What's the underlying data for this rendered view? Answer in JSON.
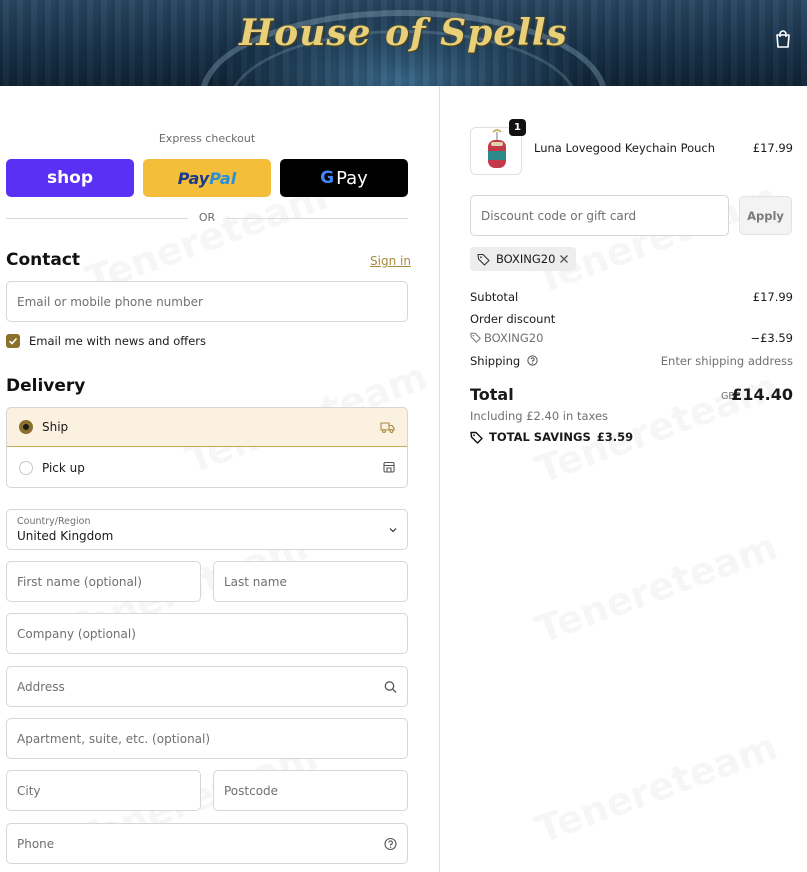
{
  "header": {
    "logo_text": "House of Spells",
    "cart_icon": "shopping-bag-icon"
  },
  "express": {
    "label": "Express checkout",
    "shop_label": "shop",
    "paypal_label_a": "Pay",
    "paypal_label_b": "Pal",
    "gpay_label_g": "G",
    "gpay_label": "Pay",
    "or_label": "OR"
  },
  "contact": {
    "heading": "Contact",
    "signin_label": "Sign in",
    "email_placeholder": "Email or mobile phone number",
    "newsletter_label": "Email me with news and offers",
    "newsletter_checked": true
  },
  "delivery": {
    "heading": "Delivery",
    "options": [
      {
        "label": "Ship",
        "selected": true,
        "icon": "truck-icon"
      },
      {
        "label": "Pick up",
        "selected": false,
        "icon": "store-icon"
      }
    ],
    "country_label": "Country/Region",
    "country_value": "United Kingdom",
    "first_name_placeholder": "First name (optional)",
    "last_name_placeholder": "Last name",
    "company_placeholder": "Company (optional)",
    "address_placeholder": "Address",
    "apartment_placeholder": "Apartment, suite, etc. (optional)",
    "city_placeholder": "City",
    "postcode_placeholder": "Postcode",
    "phone_placeholder": "Phone"
  },
  "summary": {
    "item": {
      "quantity": "1",
      "name": "Luna Lovegood Keychain Pouch",
      "price": "£17.99"
    },
    "discount_placeholder": "Discount code or gift card",
    "apply_label": "Apply",
    "applied_code": "BOXING20",
    "subtotal_label": "Subtotal",
    "subtotal_value": "£17.99",
    "order_discount_label": "Order discount",
    "order_discount_code": "BOXING20",
    "order_discount_value": "−£3.59",
    "shipping_label": "Shipping",
    "shipping_value": "Enter shipping address",
    "total_label": "Total",
    "total_currency": "GBP",
    "total_value": "£14.40",
    "taxes_note": "Including £2.40 in taxes",
    "savings_label": "TOTAL SAVINGS",
    "savings_value": "£3.59"
  },
  "colors": {
    "accent": "#8c6f2b",
    "shop_pay": "#5a31f4",
    "paypal": "#f4bd3a",
    "gold_logo": "#e8cf7a"
  }
}
